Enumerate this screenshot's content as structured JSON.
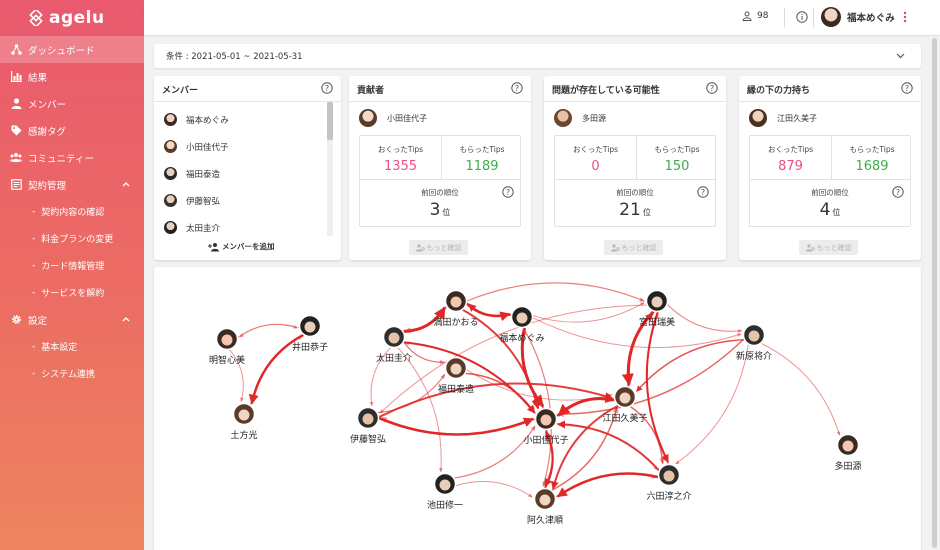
{
  "app": {
    "name": "agelu"
  },
  "sidebar": {
    "items": [
      {
        "label": "ダッシュボード",
        "active": true
      },
      {
        "label": "結果"
      },
      {
        "label": "メンバー"
      },
      {
        "label": "感謝タグ"
      },
      {
        "label": "コミュニティー"
      },
      {
        "label": "契約管理",
        "expanded": true,
        "children": [
          "契約内容の確認",
          "料金プランの変更",
          "カード情報管理",
          "サービスを解約"
        ]
      },
      {
        "label": "設定",
        "expanded": true,
        "children": [
          "基本設定",
          "システム連携"
        ]
      }
    ]
  },
  "topbar": {
    "people_count": "98",
    "user_name": "福本めぐみ"
  },
  "filter": {
    "label": "条件 : 2021-05-01 ~ 2021-05-31"
  },
  "members_card": {
    "title": "メンバー",
    "members": [
      "福本めぐみ",
      "小田佳代子",
      "福田泰造",
      "伊藤智弘",
      "太田圭介"
    ],
    "add_button": "メンバーを追加"
  },
  "stat_cards": [
    {
      "title": "貢献者",
      "person": "小田佳代子",
      "sent_label": "おくったTips",
      "sent": "1355",
      "received_label": "もらったTips",
      "received": "1189",
      "rank_label": "前回の順位",
      "rank": "3",
      "rank_unit": "位",
      "more": "もっと確認"
    },
    {
      "title": "問題が存在している可能性",
      "person": "多田源",
      "sent_label": "おくったTips",
      "sent": "0",
      "received_label": "もらったTips",
      "received": "150",
      "rank_label": "前回の順位",
      "rank": "21",
      "rank_unit": "位",
      "more": "もっと確認"
    },
    {
      "title": "縁の下の力持ち",
      "person": "江田久美子",
      "sent_label": "おくったTips",
      "sent": "879",
      "received_label": "もらったTips",
      "received": "1689",
      "rank_label": "前回の順位",
      "rank": "4",
      "rank_unit": "位",
      "more": "もっと確認"
    }
  ],
  "network": {
    "nodes": [
      {
        "id": "n1",
        "label": "明智心美"
      },
      {
        "id": "n2",
        "label": "井田恭子"
      },
      {
        "id": "n3",
        "label": "土方光"
      },
      {
        "id": "n4",
        "label": "太田圭介"
      },
      {
        "id": "n5",
        "label": "満田かおる"
      },
      {
        "id": "n6",
        "label": "福本めぐみ"
      },
      {
        "id": "n7",
        "label": "福田泰造"
      },
      {
        "id": "n8",
        "label": "伊藤智弘"
      },
      {
        "id": "n9",
        "label": "小田佳代子"
      },
      {
        "id": "n10",
        "label": "宮田瑞美"
      },
      {
        "id": "n11",
        "label": "江田久美子"
      },
      {
        "id": "n12",
        "label": "新原将介"
      },
      {
        "id": "n13",
        "label": "多田源"
      },
      {
        "id": "n14",
        "label": "池田修一"
      },
      {
        "id": "n15",
        "label": "阿久津順"
      },
      {
        "id": "n16",
        "label": "六田淳之介"
      }
    ]
  },
  "colors": {
    "accent": "#e8405a",
    "edge": "#e02828",
    "pink_value": "#ec4f86",
    "green_value": "#3cae4a"
  }
}
